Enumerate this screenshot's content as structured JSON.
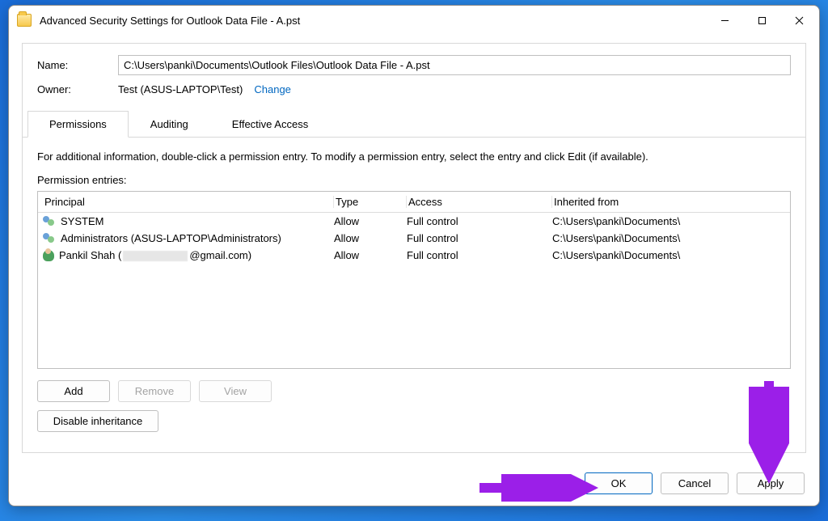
{
  "titlebar": {
    "title": "Advanced Security Settings for Outlook Data File - A.pst"
  },
  "fields": {
    "name_label": "Name:",
    "name_value": "C:\\Users\\panki\\Documents\\Outlook Files\\Outlook Data File - A.pst",
    "owner_label": "Owner:",
    "owner_value": "Test (ASUS-LAPTOP\\Test)",
    "change_label": "Change"
  },
  "tabs": {
    "permissions": "Permissions",
    "auditing": "Auditing",
    "effective": "Effective Access"
  },
  "instruction": "For additional information, double-click a permission entry. To modify a permission entry, select the entry and click Edit (if available).",
  "entries_label": "Permission entries:",
  "headers": {
    "principal": "Principal",
    "type": "Type",
    "access": "Access",
    "inherited": "Inherited from"
  },
  "entries": [
    {
      "principal": "SYSTEM",
      "icon": "group",
      "type": "Allow",
      "access": "Full control",
      "inherited": "C:\\Users\\panki\\Documents\\"
    },
    {
      "principal": "Administrators (ASUS-LAPTOP\\Administrators)",
      "icon": "group",
      "type": "Allow",
      "access": "Full control",
      "inherited": "C:\\Users\\panki\\Documents\\"
    },
    {
      "principal_prefix": "Pankil Shah (",
      "principal_suffix": "@gmail.com)",
      "icon": "user",
      "redacted": true,
      "type": "Allow",
      "access": "Full control",
      "inherited": "C:\\Users\\panki\\Documents\\"
    }
  ],
  "buttons": {
    "add": "Add",
    "remove": "Remove",
    "view": "View",
    "disable_inherit": "Disable inheritance",
    "ok": "OK",
    "cancel": "Cancel",
    "apply": "Apply"
  }
}
